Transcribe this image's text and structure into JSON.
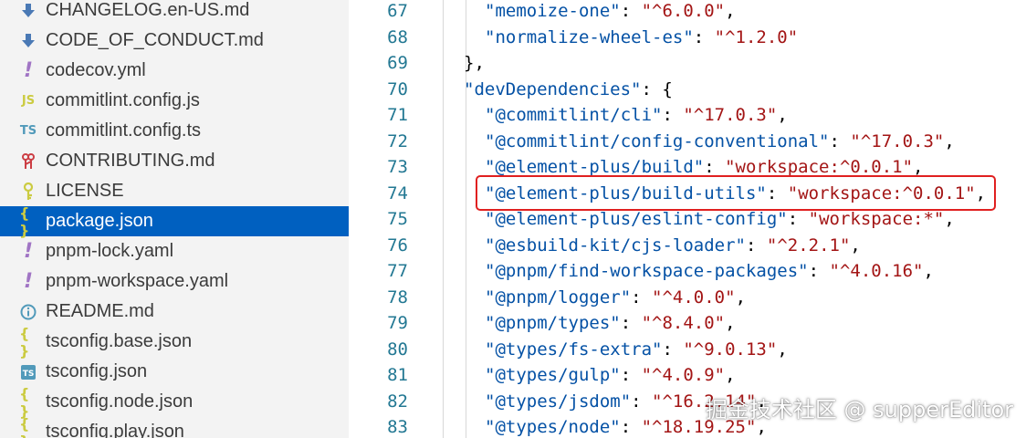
{
  "explorer": {
    "files": [
      {
        "name": "CHANGELOG.en-US.md",
        "icon": "markdown-down-arrow-icon",
        "color": "#4a79b5"
      },
      {
        "name": "CODE_OF_CONDUCT.md",
        "icon": "markdown-down-arrow-icon",
        "color": "#4a79b5"
      },
      {
        "name": "codecov.yml",
        "icon": "exclamation-icon",
        "color": "#a074c4"
      },
      {
        "name": "commitlint.config.js",
        "icon": "js-icon",
        "color": "#cbcb41"
      },
      {
        "name": "commitlint.config.ts",
        "icon": "ts-icon",
        "color": "#519aba"
      },
      {
        "name": "CONTRIBUTING.md",
        "icon": "contributing-icon",
        "color": "#cc3e44"
      },
      {
        "name": "LICENSE",
        "icon": "license-key-icon",
        "color": "#cbcb41"
      },
      {
        "name": "package.json",
        "icon": "braces-icon",
        "color": "#cbcb41",
        "selected": true
      },
      {
        "name": "pnpm-lock.yaml",
        "icon": "exclamation-icon",
        "color": "#a074c4"
      },
      {
        "name": "pnpm-workspace.yaml",
        "icon": "exclamation-icon",
        "color": "#a074c4"
      },
      {
        "name": "README.md",
        "icon": "info-icon",
        "color": "#519aba"
      },
      {
        "name": "tsconfig.base.json",
        "icon": "braces-icon",
        "color": "#cbcb41"
      },
      {
        "name": "tsconfig.json",
        "icon": "ts-box-icon",
        "color": "#519aba"
      },
      {
        "name": "tsconfig.node.json",
        "icon": "braces-icon",
        "color": "#cbcb41"
      },
      {
        "name": "tsconfig.play.json",
        "icon": "braces-icon",
        "color": "#cbcb41"
      }
    ]
  },
  "editor": {
    "lines": [
      {
        "num": "67",
        "indent": 2,
        "key": "\"memoize-one\"",
        "sep": ": ",
        "val": "\"^6.0.0\"",
        "end": ","
      },
      {
        "num": "68",
        "indent": 2,
        "key": "\"normalize-wheel-es\"",
        "sep": ": ",
        "val": "\"^1.2.0\"",
        "end": ""
      },
      {
        "num": "69",
        "indent": 1,
        "key": "",
        "sep": "",
        "val": "",
        "end": "},"
      },
      {
        "num": "70",
        "indent": 1,
        "key": "\"devDependencies\"",
        "sep": ": ",
        "val": "",
        "end": "{"
      },
      {
        "num": "71",
        "indent": 2,
        "key": "\"@commitlint/cli\"",
        "sep": ": ",
        "val": "\"^17.0.3\"",
        "end": ","
      },
      {
        "num": "72",
        "indent": 2,
        "key": "\"@commitlint/config-conventional\"",
        "sep": ": ",
        "val": "\"^17.0.3\"",
        "end": ","
      },
      {
        "num": "73",
        "indent": 2,
        "key": "\"@element-plus/build\"",
        "sep": ": ",
        "val": "\"workspace:^0.0.1\"",
        "end": ","
      },
      {
        "num": "74",
        "indent": 2,
        "key": "\"@element-plus/build-utils\"",
        "sep": ": ",
        "val": "\"workspace:^0.0.1\"",
        "end": ","
      },
      {
        "num": "75",
        "indent": 2,
        "key": "\"@element-plus/eslint-config\"",
        "sep": ": ",
        "val": "\"workspace:*\"",
        "end": ","
      },
      {
        "num": "76",
        "indent": 2,
        "key": "\"@esbuild-kit/cjs-loader\"",
        "sep": ": ",
        "val": "\"^2.2.1\"",
        "end": ","
      },
      {
        "num": "77",
        "indent": 2,
        "key": "\"@pnpm/find-workspace-packages\"",
        "sep": ": ",
        "val": "\"^4.0.16\"",
        "end": ","
      },
      {
        "num": "78",
        "indent": 2,
        "key": "\"@pnpm/logger\"",
        "sep": ": ",
        "val": "\"^4.0.0\"",
        "end": ","
      },
      {
        "num": "79",
        "indent": 2,
        "key": "\"@pnpm/types\"",
        "sep": ": ",
        "val": "\"^8.4.0\"",
        "end": ","
      },
      {
        "num": "80",
        "indent": 2,
        "key": "\"@types/fs-extra\"",
        "sep": ": ",
        "val": "\"^9.0.13\"",
        "end": ","
      },
      {
        "num": "81",
        "indent": 2,
        "key": "\"@types/gulp\"",
        "sep": ": ",
        "val": "\"^4.0.9\"",
        "end": ","
      },
      {
        "num": "82",
        "indent": 2,
        "key": "\"@types/jsdom\"",
        "sep": ": ",
        "val": "\"^16.2.14\"",
        "end": ","
      },
      {
        "num": "83",
        "indent": 2,
        "key": "\"@types/node\"",
        "sep": ": ",
        "val": "\"^18.19.25\"",
        "end": ","
      }
    ],
    "highlighted_line": "74"
  },
  "watermark": "掘金技术社区 @ supperEditor",
  "colors": {
    "selection": "#0060c0",
    "line_number": "#237893",
    "json_key": "#0451a5",
    "json_string": "#a31515",
    "highlight_border": "#e02020"
  }
}
